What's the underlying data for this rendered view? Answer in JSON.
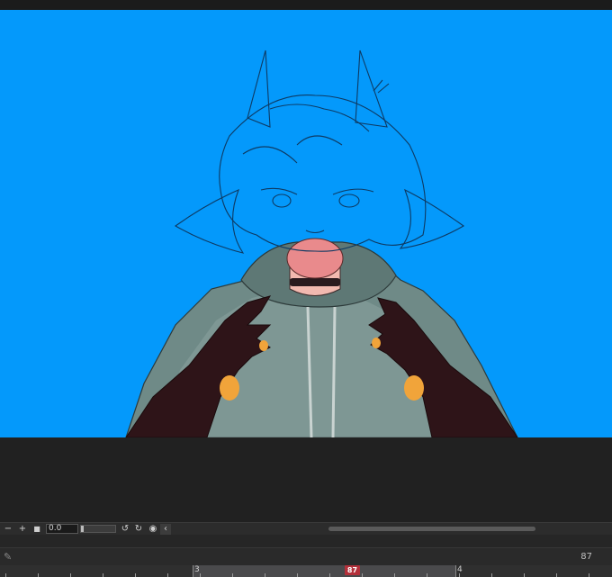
{
  "canvas": {
    "background_color": "#0499fb",
    "artwork": "character-illustration"
  },
  "transport": {
    "minus_icon": "−",
    "plus_icon": "+",
    "stop_icon": "■",
    "speed_value": "0.0",
    "loop_icon": "↺",
    "loop2_icon": "↻",
    "record_icon": "◉",
    "collapse_icon": "‹"
  },
  "timeline": {
    "current_frame": "87",
    "playhead_label": "87",
    "seconds": [
      {
        "label": "3"
      },
      {
        "label": "4"
      }
    ]
  }
}
